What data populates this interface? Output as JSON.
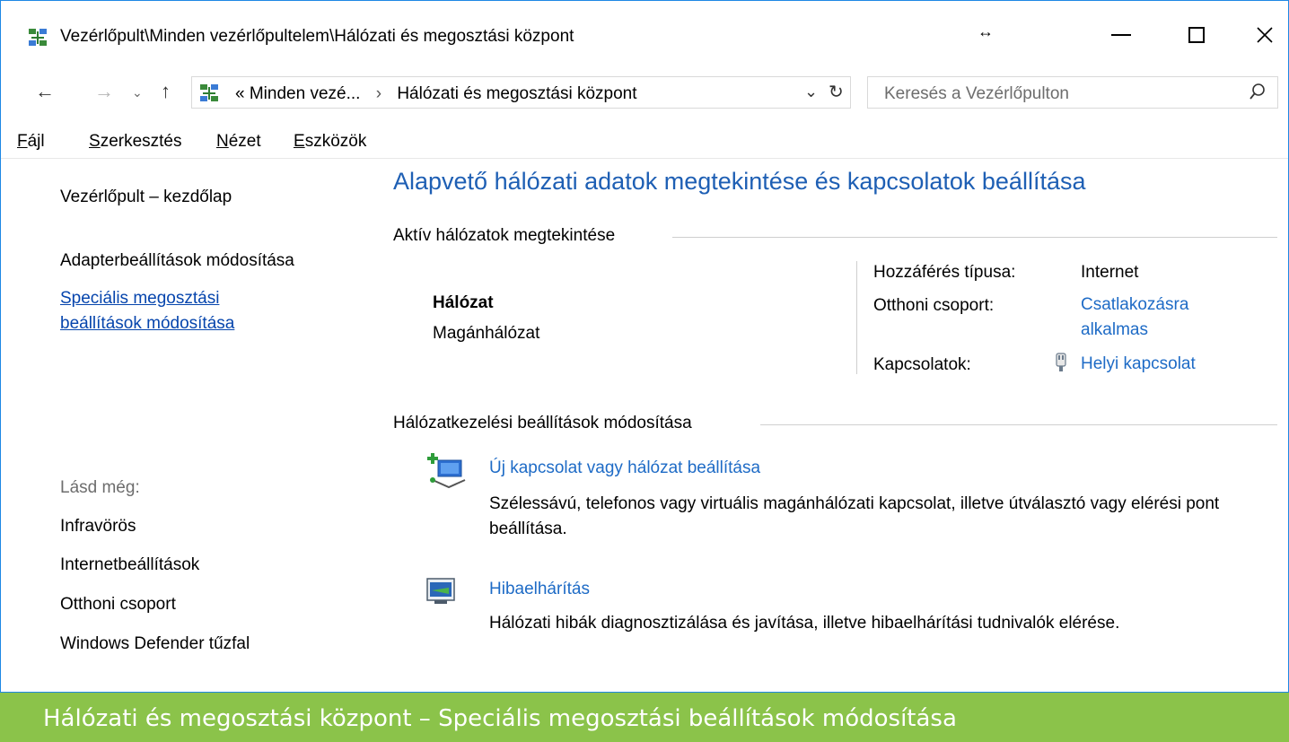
{
  "window": {
    "title": "Vezérlőpult\\Minden vezérlőpultelem\\Hálózati és megosztási központ",
    "resize_indicator": "↔"
  },
  "navbar": {
    "address_prefix": "«",
    "address_parent": "Minden vezé...",
    "address_separator": "›",
    "address_current": "Hálózati és megosztási központ",
    "search_placeholder": "Keresés a Vezérlőpulton"
  },
  "menu": {
    "items": [
      {
        "first": "F",
        "rest": "ájl"
      },
      {
        "first": "S",
        "rest": "zerkesztés"
      },
      {
        "first": "N",
        "rest": "ézet"
      },
      {
        "first": "E",
        "rest": "szközök"
      }
    ]
  },
  "sidebar": {
    "home": "Vezérlőpult – kezdőlap",
    "adapter": "Adapterbeállítások módosítása",
    "sharing_line1": "Speciális megosztási",
    "sharing_line2": "beállítások módosítása",
    "see_also": "Lásd még:",
    "links": [
      "Infravörös",
      "Internetbeállítások",
      "Otthoni csoport",
      "Windows Defender tűzfal"
    ]
  },
  "main": {
    "title": "Alapvető hálózati adatok megtekintése és kapcsolatok beállítása",
    "active_section": "Aktív hálózatok megtekintése",
    "network_name": "Hálózat",
    "network_type": "Magánhálózat",
    "access_label": "Hozzáférés típusa:",
    "access_value": "Internet",
    "homegroup_label": "Otthoni csoport:",
    "homegroup_value_1": "Csatlakozásra",
    "homegroup_value_2": "alkalmas",
    "connections_label": "Kapcsolatok:",
    "connections_value": "Helyi kapcsolat",
    "settings_section": "Hálózatkezelési beállítások módosítása",
    "task1_link": "Új kapcsolat vagy hálózat beállítása",
    "task1_desc": "Szélessávú, telefonos vagy virtuális magánhálózati kapcsolat, illetve útválasztó vagy elérési pont beállítása.",
    "task2_link": "Hibaelhárítás",
    "task2_desc": "Hálózati hibák diagnosztizálása és javítása, illetve hibaelhárítási tudnivalók elérése."
  },
  "caption": {
    "text": "Hálózati és megosztási központ – Speciális megosztási beállítások módosítása",
    "color": "#8bc34a"
  },
  "colors": {
    "link": "#1e6bc6",
    "title": "#1e5fb4",
    "window_border": "#1e88e5"
  }
}
